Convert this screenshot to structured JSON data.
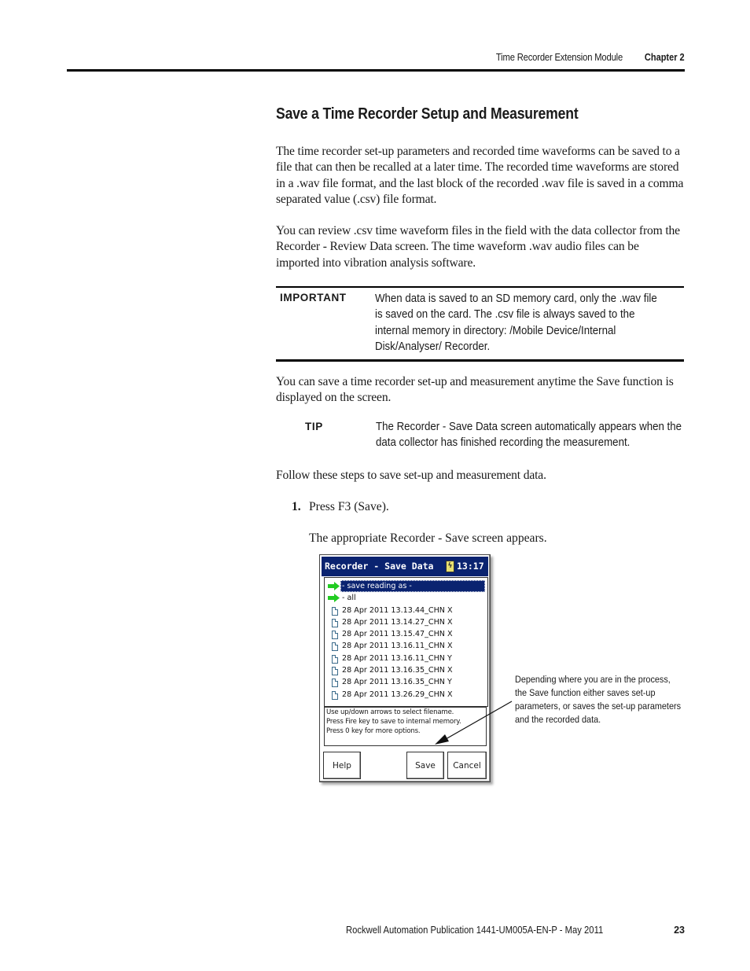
{
  "header": {
    "title": "Time Recorder Extension Module",
    "chapter": "Chapter 2"
  },
  "section": {
    "title": "Save a Time Recorder Setup and Measurement",
    "paragraphs": [
      "The time recorder set-up parameters and recorded time waveforms can be saved to a file that can then be recalled at a later time. The recorded time waveforms are stored in a .wav file format, and the last block of the recorded .wav file is saved in a comma separated value (.csv) file format.",
      "You can review .csv time waveform files in the field with the data collector from the Recorder - Review Data screen. The time waveform .wav audio files can be imported into vibration analysis software.",
      "You can save a time recorder set-up and measurement anytime the Save function is displayed on the screen.",
      "Follow these steps to save set-up and measurement data."
    ],
    "important": {
      "label": "IMPORTANT",
      "text": "When data is saved to an SD memory card, only the .wav file is saved on the card. The .csv file is always saved to the internal memory in directory: /Mobile Device/Internal Disk/Analyser/ Recorder."
    },
    "tip": {
      "label": "TIP",
      "text": "The Recorder - Save Data screen automatically appears when the data collector has finished recording the measurement."
    },
    "steps": [
      {
        "number": "1.",
        "text": "Press F3 (Save).",
        "result": "The appropriate Recorder - Save screen appears."
      }
    ]
  },
  "device_screen": {
    "title": "Recorder - Save Data",
    "battery_icon": "battery-charging-icon",
    "time": "13:17",
    "list_items": [
      {
        "icon": "green-arrow-icon",
        "label": "- save reading as -",
        "selected": true
      },
      {
        "icon": "green-arrow-icon",
        "label": "- all",
        "selected": false
      },
      {
        "icon": "file-icon",
        "label": "28 Apr 2011 13.13.44_CHN X",
        "selected": false
      },
      {
        "icon": "file-icon",
        "label": "28 Apr 2011 13.14.27_CHN X",
        "selected": false
      },
      {
        "icon": "file-icon",
        "label": "28 Apr 2011 13.15.47_CHN X",
        "selected": false
      },
      {
        "icon": "file-icon",
        "label": "28 Apr 2011 13.16.11_CHN X",
        "selected": false
      },
      {
        "icon": "file-icon",
        "label": "28 Apr 2011 13.16.11_CHN Y",
        "selected": false
      },
      {
        "icon": "file-icon",
        "label": "28 Apr 2011 13.16.35_CHN X",
        "selected": false
      },
      {
        "icon": "file-icon",
        "label": "28 Apr 2011 13.16.35_CHN Y",
        "selected": false
      },
      {
        "icon": "file-icon",
        "label": "28 Apr 2011 13.26.29_CHN X",
        "selected": false
      }
    ],
    "help_lines": [
      "Use up/down arrows to select filename.",
      "Press Fire key to save to internal memory.",
      "Press 0 key for more options."
    ],
    "buttons": {
      "help": "Help",
      "save": "Save",
      "cancel": "Cancel"
    }
  },
  "callout": {
    "text": "Depending where you are in the process, the Save function either saves set-up parameters, or saves the set-up parameters and the recorded data."
  },
  "footer": {
    "publication": "Rockwell Automation Publication 1441-UM005A-EN-P - May 2011",
    "page_number": "23"
  },
  "colors": {
    "titlebar": "#0a2370",
    "arrow_green": "#22cc22"
  }
}
